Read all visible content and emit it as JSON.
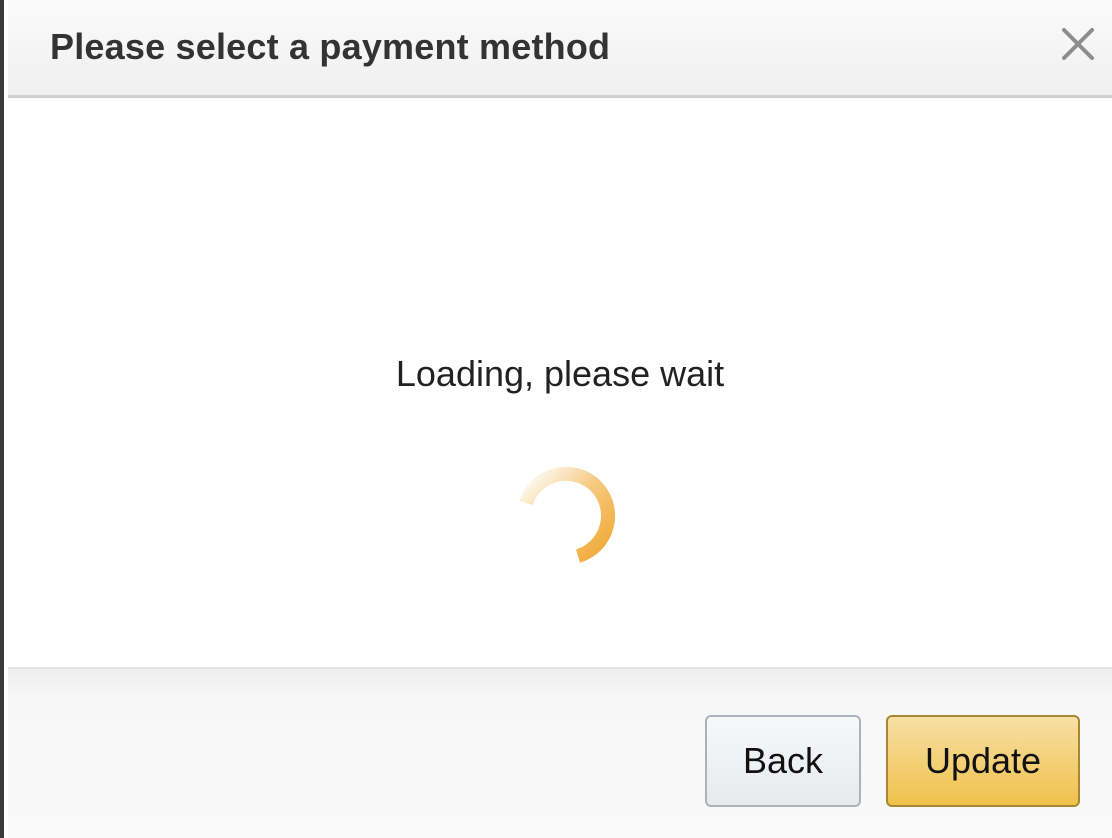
{
  "dialog": {
    "title": "Please select a payment method",
    "close_icon": "close-icon"
  },
  "body": {
    "loading_text": "Loading, please wait",
    "spinner_icon": "loading-spinner-icon"
  },
  "footer": {
    "back_label": "Back",
    "update_label": "Update"
  },
  "colors": {
    "accent": "#f0c14b",
    "spinner": "#f0a832",
    "title": "#333333"
  }
}
